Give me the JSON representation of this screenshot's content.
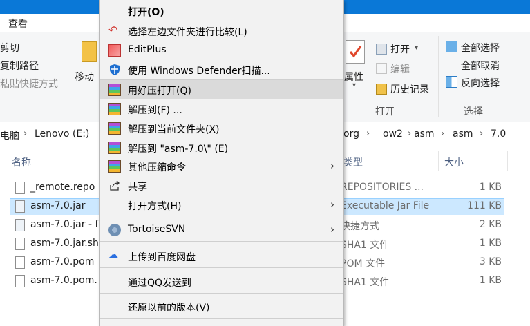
{
  "menubar": {
    "view": "查看"
  },
  "ribbon": {
    "clipboard": [
      "剪切",
      "复制路径",
      "粘贴快捷方式"
    ],
    "move_to": "移动",
    "properties": "属性",
    "open_group": {
      "open": "打开",
      "edit": "编辑",
      "history": "历史记录",
      "group_label": "打开"
    },
    "select_group": {
      "select_all": "全部选择",
      "select_none": "全部取消",
      "invert": "反向选择",
      "group_label": "选择"
    }
  },
  "address": {
    "left": [
      "电脑",
      "Lenovo (E:)"
    ],
    "right": [
      "org",
      "ow2",
      "asm",
      "asm",
      "7.0"
    ]
  },
  "columns": {
    "name": "名称",
    "type": "类型",
    "size": "大小"
  },
  "files": [
    {
      "name": "_remote.repo",
      "type": "REPOSITORIES ...",
      "size": "1 KB"
    },
    {
      "name": "asm-7.0.jar",
      "type": "Executable Jar File",
      "size": "111 KB"
    },
    {
      "name": "asm-7.0.jar - f",
      "type": "快捷方式",
      "size": "2 KB"
    },
    {
      "name": "asm-7.0.jar.sh",
      "type": "SHA1 文件",
      "size": "1 KB"
    },
    {
      "name": "asm-7.0.pom",
      "type": "POM 文件",
      "size": "3 KB"
    },
    {
      "name": "asm-7.0.pom.",
      "type": "SHA1 文件",
      "size": "1 KB"
    }
  ],
  "context_menu": {
    "open": "打开(O)",
    "compare": "选择左边文件夹进行比较(L)",
    "editplus": "EditPlus",
    "defender": "使用 Windows Defender扫描...",
    "haozip_open": "用好压打开(Q)",
    "extract_to": "解压到(F) ...",
    "extract_here": "解压到当前文件夹(X)",
    "extract_named": "解压到 \"asm-7.0\\\" (E)",
    "other_compress": "其他压缩命令",
    "share": "共享",
    "open_with": "打开方式(H)",
    "tortoise": "TortoiseSVN",
    "baidu": "上传到百度网盘",
    "qq_send": "通过QQ发送到",
    "restore": "还原以前的版本(V)"
  }
}
